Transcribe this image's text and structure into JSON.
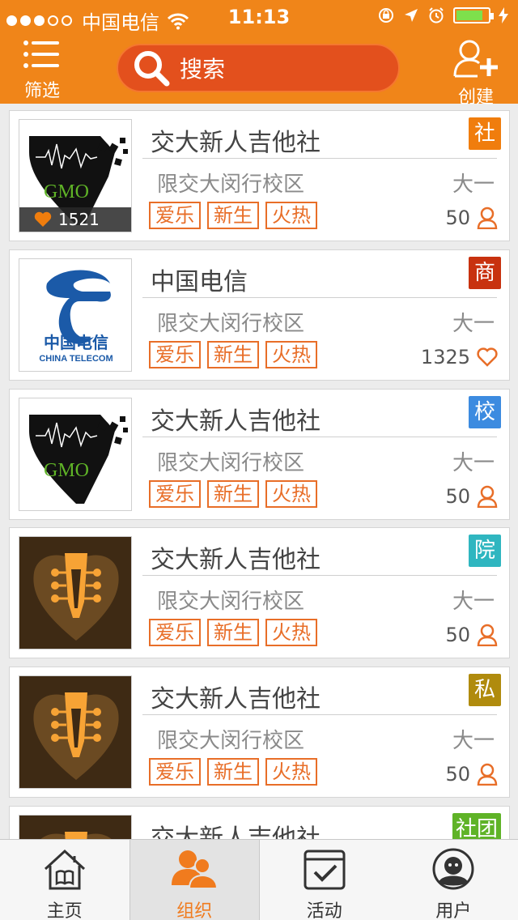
{
  "status_bar": {
    "carrier": "中国电信",
    "time": "11:13",
    "signal_full": 3,
    "signal_empty": 2
  },
  "header": {
    "filter_label": "筛选",
    "search_placeholder": "搜索",
    "create_label": "创建"
  },
  "colors": {
    "brand": "#f08519",
    "search_bg": "#e3501d",
    "tag_she": "#f07d0d",
    "tag_shang": "#c8320f",
    "tag_xiao": "#3c8be0",
    "tag_yuan": "#2fb6c0",
    "tag_si": "#b08b0d",
    "tag_shetuan": "#5fb327"
  },
  "cards": [
    {
      "title": "交大新人吉他社",
      "tag": "社",
      "campus": "限交大闵行校区",
      "grade": "大一",
      "labels": [
        "爱乐",
        "新生",
        "火热"
      ],
      "count": "50",
      "count_icon": "person-icon",
      "likes": "1521",
      "logo": "gmo-pick"
    },
    {
      "title": "中国电信",
      "tag": "商",
      "campus": "限交大闵行校区",
      "grade": "大一",
      "labels": [
        "爱乐",
        "新生",
        "火热"
      ],
      "count": "1325",
      "count_icon": "heart-icon",
      "logo": "china-telecom",
      "logo_cn": "中国电信",
      "logo_en": "CHINA TELECOM"
    },
    {
      "title": "交大新人吉他社",
      "tag": "校",
      "campus": "限交大闵行校区",
      "grade": "大一",
      "labels": [
        "爱乐",
        "新生",
        "火热"
      ],
      "count": "50",
      "count_icon": "person-icon",
      "logo": "gmo-pick"
    },
    {
      "title": "交大新人吉他社",
      "tag": "院",
      "campus": "限交大闵行校区",
      "grade": "大一",
      "labels": [
        "爱乐",
        "新生",
        "火热"
      ],
      "count": "50",
      "count_icon": "person-icon",
      "logo": "guitar-heart"
    },
    {
      "title": "交大新人吉他社",
      "tag": "私",
      "campus": "限交大闵行校区",
      "grade": "大一",
      "labels": [
        "爱乐",
        "新生",
        "火热"
      ],
      "count": "50",
      "count_icon": "person-icon",
      "logo": "guitar-heart"
    },
    {
      "title": "交大新人吉他社",
      "tag": "社团",
      "logo": "guitar-heart"
    }
  ],
  "tabs": [
    {
      "label": "主页",
      "icon": "home-icon"
    },
    {
      "label": "组织",
      "icon": "group-icon",
      "active": true
    },
    {
      "label": "活动",
      "icon": "calendar-check-icon"
    },
    {
      "label": "用户",
      "icon": "user-face-icon"
    }
  ]
}
